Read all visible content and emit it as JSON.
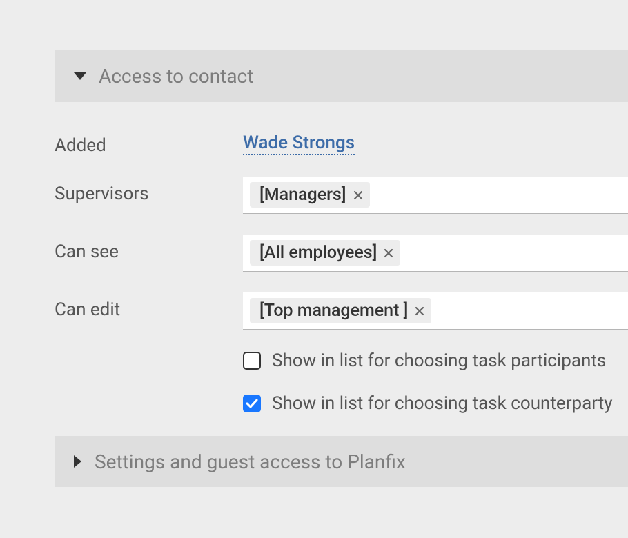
{
  "section1": {
    "title": "Access to contact",
    "expanded": true
  },
  "fields": {
    "added": {
      "label": "Added",
      "value": "Wade Strongs"
    },
    "supervisors": {
      "label": "Supervisors",
      "tag": "[Managers]"
    },
    "canSee": {
      "label": "Can see",
      "tag": "[All employees]"
    },
    "canEdit": {
      "label": "Can edit",
      "tag": "[Top management ]"
    }
  },
  "options": {
    "participants": {
      "label": "Show in list for choosing task participants",
      "checked": false
    },
    "counterparty": {
      "label": "Show in list for choosing task counterparty",
      "checked": true
    }
  },
  "section2": {
    "title": "Settings and guest access to Planfix",
    "expanded": false
  }
}
